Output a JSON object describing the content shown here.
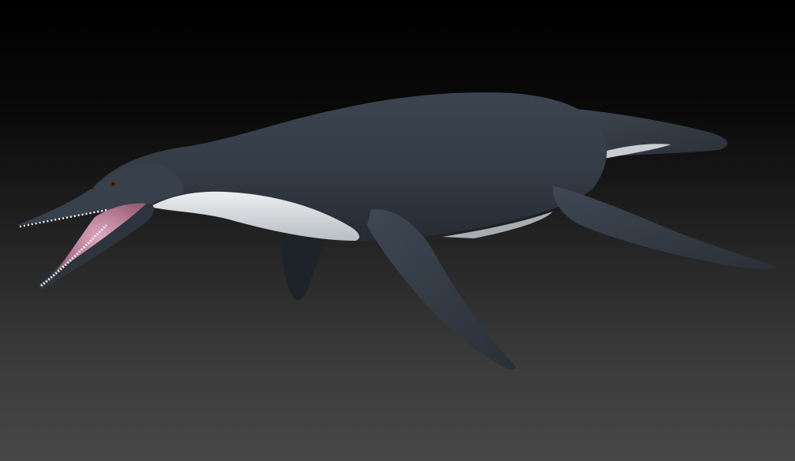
{
  "scene": {
    "subject": "marine-reptile-render",
    "colors": {
      "background_top": "#000000",
      "background_bottom": "#474747",
      "skin_dark": "#2b323b",
      "skin_mid": "#3d4652",
      "belly": "#d9dcdf",
      "mouth": "#c98aa6",
      "teeth": "#f2f2f2"
    }
  }
}
